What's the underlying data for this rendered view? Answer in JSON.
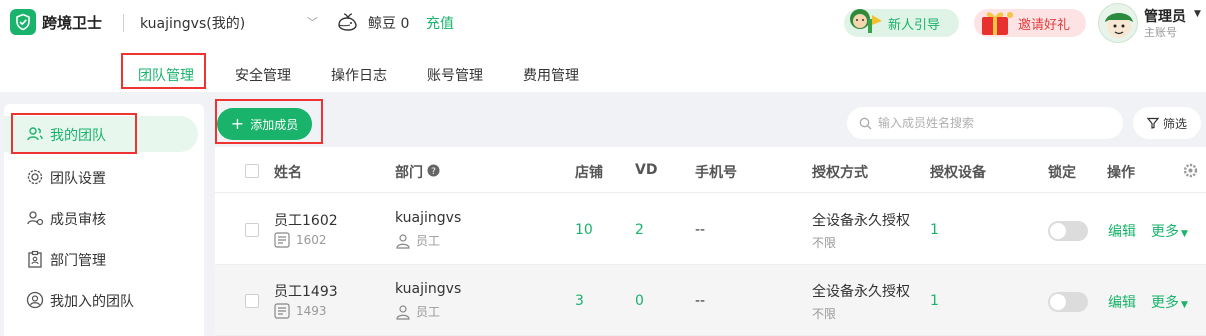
{
  "app": {
    "name": "跨境卫士"
  },
  "account": {
    "name": "kuajingvs(我的)",
    "beans": "鲸豆 0",
    "recharge": "充值"
  },
  "header": {
    "guide": "新人引导",
    "invite": "邀请好礼",
    "user_name": "管理员",
    "user_role": "主账号"
  },
  "tabs": [
    "团队管理",
    "安全管理",
    "操作日志",
    "账号管理",
    "费用管理"
  ],
  "sidebar": {
    "items": [
      {
        "label": "我的团队",
        "icon": "user-group-icon",
        "active": true
      },
      {
        "label": "团队设置",
        "icon": "gear-icon"
      },
      {
        "label": "成员审核",
        "icon": "user-check-icon"
      },
      {
        "label": "部门管理",
        "icon": "clipboard-icon"
      },
      {
        "label": "我加入的团队",
        "icon": "user-circle-icon"
      }
    ]
  },
  "toolbar": {
    "add_label": "添加成员",
    "search_placeholder": "输入成员姓名搜索",
    "filter_label": "筛选"
  },
  "table": {
    "headers": [
      "姓名",
      "部门",
      "店铺",
      "VD",
      "手机号",
      "授权方式",
      "授权设备",
      "锁定",
      "操作"
    ],
    "rows": [
      {
        "name": "员工1602",
        "id": "1602",
        "dept": "kuajingvs",
        "role": "员工",
        "shops": "10",
        "vd": "2",
        "phone": "--",
        "auth": "全设备永久授权",
        "limit": "不限",
        "devices": "1",
        "edit": "编辑",
        "more": "更多"
      },
      {
        "name": "员工1493",
        "id": "1493",
        "dept": "kuajingvs",
        "role": "员工",
        "shops": "3",
        "vd": "0",
        "phone": "--",
        "auth": "全设备永久授权",
        "limit": "不限",
        "devices": "1",
        "edit": "编辑",
        "more": "更多"
      }
    ]
  },
  "colors": {
    "accent": "#19b36b",
    "highlight": "#ee3333"
  }
}
